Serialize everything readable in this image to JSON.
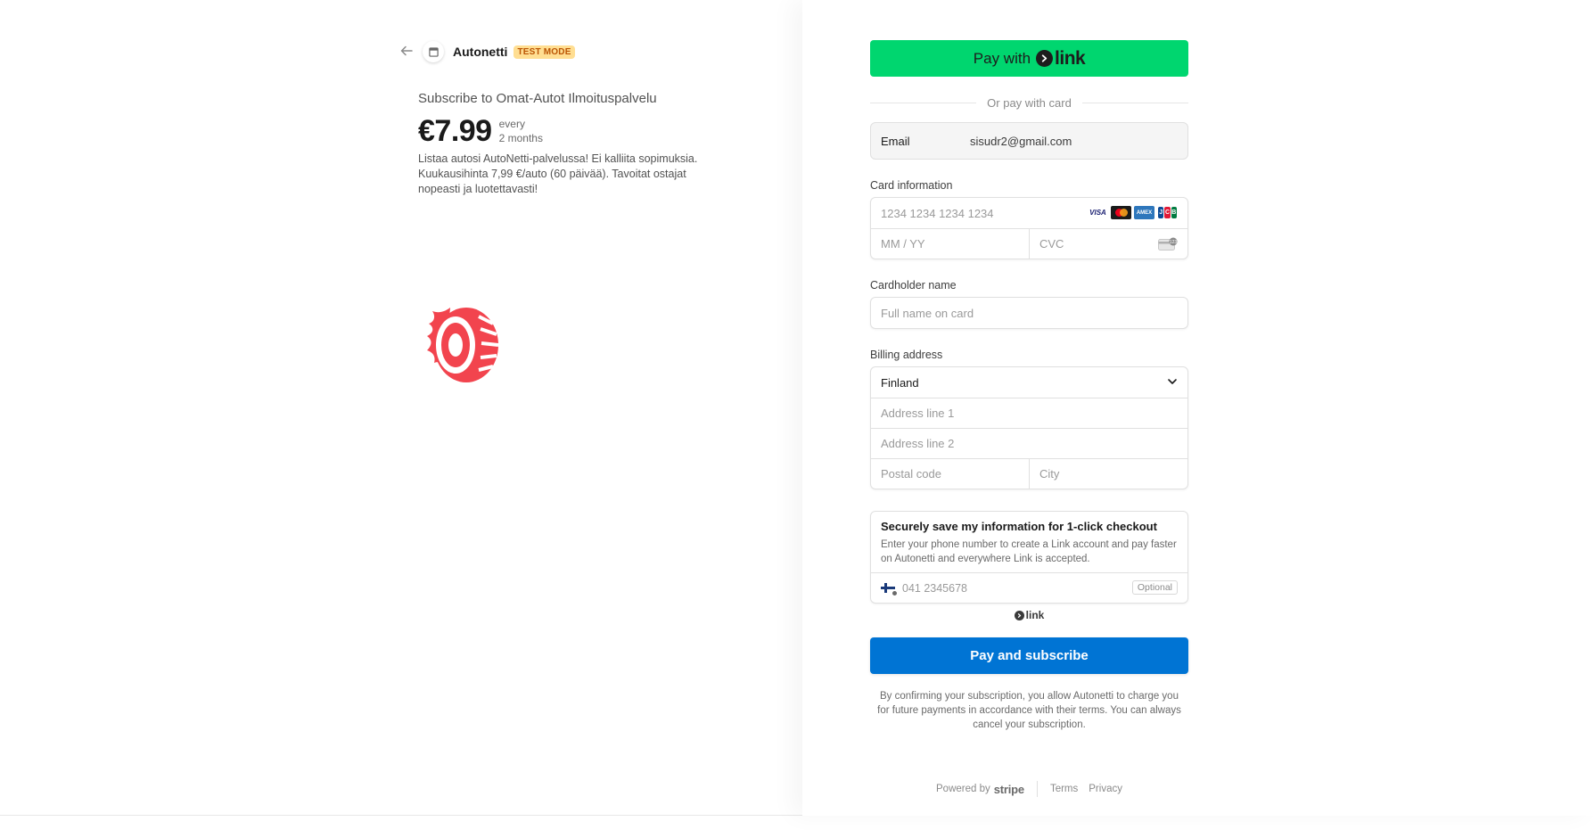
{
  "merchant": {
    "name": "Autonetti",
    "badge": "TEST MODE"
  },
  "product": {
    "title": "Subscribe to Omat-Autot Ilmoituspalvelu",
    "price": "€7.99",
    "interval_line1": "every",
    "interval_line2": "2 months",
    "description": "Listaa autosi AutoNetti-palvelussa! Ei kalliita sopimuksia. Kuukausihinta 7,99 €/auto (60 päivää). Tavoitat ostajat nopeasti ja luotettavasti!"
  },
  "link_button": {
    "prefix": "Pay with",
    "brand": "link"
  },
  "divider_text": "Or pay with card",
  "email": {
    "label": "Email",
    "value": "sisudr2@gmail.com"
  },
  "card": {
    "label": "Card information",
    "number_placeholder": "1234 1234 1234 1234",
    "expiry_placeholder": "MM / YY",
    "cvc_placeholder": "CVC",
    "brands": [
      "VISA",
      "Mastercard",
      "AMEX",
      "JCB"
    ]
  },
  "cardholder": {
    "label": "Cardholder name",
    "placeholder": "Full name on card"
  },
  "billing": {
    "label": "Billing address",
    "country": "Finland",
    "line1_placeholder": "Address line 1",
    "line2_placeholder": "Address line 2",
    "postal_placeholder": "Postal code",
    "city_placeholder": "City"
  },
  "save_info": {
    "title": "Securely save my information for 1-click checkout",
    "subtitle": "Enter your phone number to create a Link account and pay faster on Autonetti and everywhere Link is accepted.",
    "phone_placeholder": "041 2345678",
    "optional_label": "Optional",
    "link_brand": "link"
  },
  "pay_button": "Pay and subscribe",
  "disclaimer": "By confirming your subscription, you allow Autonetti to charge you for future payments in accordance with their terms. You can always cancel your subscription.",
  "footer": {
    "powered_by": "Powered by",
    "stripe": "stripe",
    "terms": "Terms",
    "privacy": "Privacy"
  },
  "colors": {
    "link_green": "#00d66f",
    "pay_blue": "#0074d4",
    "badge_bg": "#ffde92",
    "badge_text": "#bb5504",
    "logo_red": "#f2444e"
  },
  "icons": {
    "back": "arrow-left-icon",
    "brand": "store-icon",
    "logo": "flaming-tire-logo",
    "chevron": "chevron-down-icon",
    "cvc": "cvc-card-icon",
    "flag": "finland-flag-icon"
  }
}
